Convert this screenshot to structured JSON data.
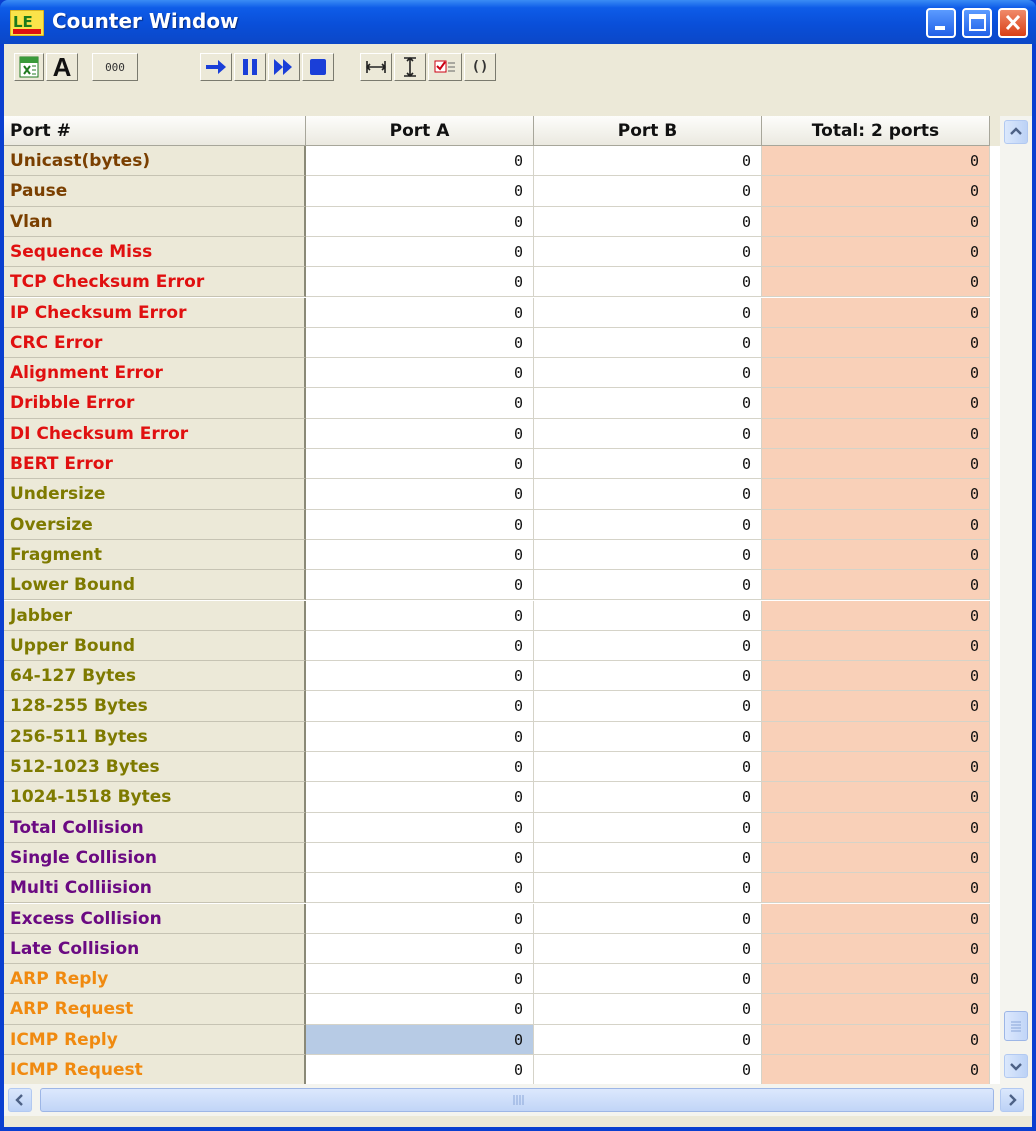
{
  "window": {
    "title": "Counter Window",
    "app_icon": "le-app-icon"
  },
  "toolbar": {
    "buttons": [
      {
        "name": "export-excel-button",
        "icon": "excel-icon"
      },
      {
        "name": "font-button",
        "label": "A",
        "icon": "font-icon"
      },
      {
        "name": "number-format-button",
        "label": "000",
        "icon": "number-format-icon"
      },
      {
        "name": "start-button",
        "icon": "arrow-right-icon"
      },
      {
        "name": "pause-button",
        "icon": "pause-icon"
      },
      {
        "name": "fast-forward-button",
        "icon": "fast-forward-icon"
      },
      {
        "name": "stop-button",
        "icon": "stop-icon"
      },
      {
        "name": "fit-width-button",
        "icon": "horizontal-resize-icon"
      },
      {
        "name": "fit-height-button",
        "icon": "vertical-resize-icon"
      },
      {
        "name": "select-counters-button",
        "icon": "checklist-icon"
      },
      {
        "name": "clear-button",
        "label": "()",
        "icon": "brackets-icon"
      }
    ]
  },
  "grid": {
    "columns": [
      "Port #",
      "Port A",
      "Port B",
      "Total: 2 ports"
    ],
    "rows": [
      {
        "label": "Unicast(bytes)",
        "color": "#7a3f00",
        "a": "0",
        "b": "0",
        "total": "0"
      },
      {
        "label": "Pause",
        "color": "#7a3f00",
        "a": "0",
        "b": "0",
        "total": "0"
      },
      {
        "label": "Vlan",
        "color": "#7a3f00",
        "a": "0",
        "b": "0",
        "total": "0"
      },
      {
        "label": "Sequence Miss",
        "color": "#e01010",
        "a": "0",
        "b": "0",
        "total": "0"
      },
      {
        "label": "TCP Checksum Error",
        "color": "#e01010",
        "a": "0",
        "b": "0",
        "total": "0"
      },
      {
        "label": "IP Checksum Error",
        "color": "#e01010",
        "a": "0",
        "b": "0",
        "total": "0"
      },
      {
        "label": "CRC Error",
        "color": "#e01010",
        "a": "0",
        "b": "0",
        "total": "0"
      },
      {
        "label": "Alignment Error",
        "color": "#e01010",
        "a": "0",
        "b": "0",
        "total": "0"
      },
      {
        "label": "Dribble Error",
        "color": "#e01010",
        "a": "0",
        "b": "0",
        "total": "0"
      },
      {
        "label": "DI Checksum Error",
        "color": "#e01010",
        "a": "0",
        "b": "0",
        "total": "0"
      },
      {
        "label": "BERT Error",
        "color": "#e01010",
        "a": "0",
        "b": "0",
        "total": "0"
      },
      {
        "label": "Undersize",
        "color": "#7e7a00",
        "a": "0",
        "b": "0",
        "total": "0"
      },
      {
        "label": "Oversize",
        "color": "#7e7a00",
        "a": "0",
        "b": "0",
        "total": "0"
      },
      {
        "label": "Fragment",
        "color": "#7e7a00",
        "a": "0",
        "b": "0",
        "total": "0"
      },
      {
        "label": "Lower Bound",
        "color": "#7e7a00",
        "a": "0",
        "b": "0",
        "total": "0"
      },
      {
        "label": "Jabber",
        "color": "#7e7a00",
        "a": "0",
        "b": "0",
        "total": "0"
      },
      {
        "label": "Upper Bound",
        "color": "#7e7a00",
        "a": "0",
        "b": "0",
        "total": "0"
      },
      {
        "label": "64-127 Bytes",
        "color": "#7e7a00",
        "a": "0",
        "b": "0",
        "total": "0"
      },
      {
        "label": "128-255 Bytes",
        "color": "#7e7a00",
        "a": "0",
        "b": "0",
        "total": "0"
      },
      {
        "label": "256-511 Bytes",
        "color": "#7e7a00",
        "a": "0",
        "b": "0",
        "total": "0"
      },
      {
        "label": "512-1023 Bytes",
        "color": "#7e7a00",
        "a": "0",
        "b": "0",
        "total": "0"
      },
      {
        "label": "1024-1518 Bytes",
        "color": "#7e7a00",
        "a": "0",
        "b": "0",
        "total": "0"
      },
      {
        "label": "Total Collision",
        "color": "#6b0a82",
        "a": "0",
        "b": "0",
        "total": "0"
      },
      {
        "label": "Single Collision",
        "color": "#6b0a82",
        "a": "0",
        "b": "0",
        "total": "0"
      },
      {
        "label": "Multi Colliision",
        "color": "#6b0a82",
        "a": "0",
        "b": "0",
        "total": "0"
      },
      {
        "label": "Excess Collision",
        "color": "#6b0a82",
        "a": "0",
        "b": "0",
        "total": "0"
      },
      {
        "label": "Late Collision",
        "color": "#6b0a82",
        "a": "0",
        "b": "0",
        "total": "0"
      },
      {
        "label": "ARP Reply",
        "color": "#f08a10",
        "a": "0",
        "b": "0",
        "total": "0"
      },
      {
        "label": "ARP Request",
        "color": "#f08a10",
        "a": "0",
        "b": "0",
        "total": "0"
      },
      {
        "label": "ICMP Reply",
        "color": "#f08a10",
        "a": "0",
        "b": "0",
        "total": "0",
        "selected_cell": "a"
      },
      {
        "label": "ICMP Request",
        "color": "#f08a10",
        "a": "0",
        "b": "0",
        "total": "0"
      }
    ]
  },
  "colors": {
    "title_bar": "#0a4fd9",
    "total_column": "#f9d0b8",
    "selected_cell": "#b7cbe5"
  }
}
